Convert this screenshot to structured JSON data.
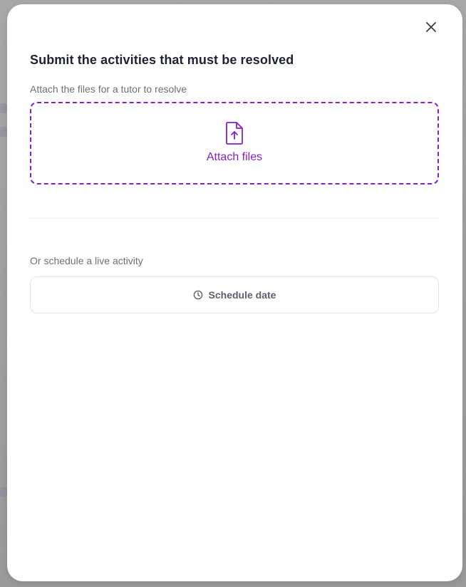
{
  "modal": {
    "title": "Submit the activities that must be resolved",
    "close_icon": "close-icon",
    "attach": {
      "label": "Attach the files for a tutor to resolve",
      "button_label": "Attach files",
      "icon": "file-upload-icon",
      "accent_color": "#8a1fc9"
    },
    "schedule": {
      "label": "Or schedule a live activity",
      "button_label": "Schedule date",
      "icon": "clock-icon"
    }
  }
}
